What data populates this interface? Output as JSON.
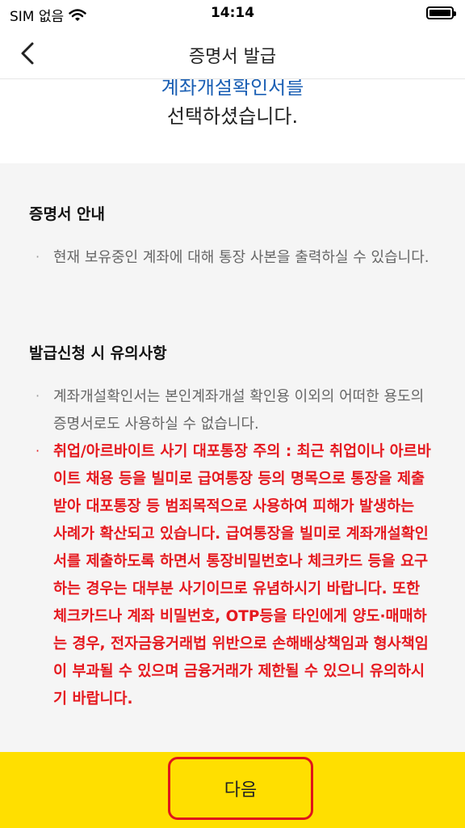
{
  "status_bar": {
    "carrier": "SIM 없음",
    "time": "14:14"
  },
  "nav": {
    "title": "증명서 발급"
  },
  "selection": {
    "document_name": "계좌개설확인서를",
    "selected_text": "선택하셨습니다."
  },
  "info": {
    "heading": "증명서 안내",
    "items": [
      "현재 보유중인 계좌에 대해 통장 사본을 출력하실 수 있습니다."
    ]
  },
  "notice": {
    "heading": "발급신청 시 유의사항",
    "items": [
      "계좌개설확인서는 본인계좌개설 확인용 이외의 어떠한 용도의 증명서로도 사용하실 수 없습니다.",
      "취업/아르바이트 사기 대포통장 주의 : 최근 취업이나 아르바이트 채용 등을 빌미로 급여통장 등의 명목으로 통장을 제출받아 대포통장 등 범죄목적으로 사용하여 피해가 발생하는 사례가 확산되고 있습니다. 급여통장을 빌미로 계좌개설확인서를 제출하도록 하면서 통장비밀번호나 체크카드 등을 요구하는 경우는 대부분 사기이므로 유념하시기 바랍니다. 또한 체크카드나 계좌 비밀번호, OTP등을 타인에게 양도·매매하는 경우, 전자금융거래법 위반으로 손해배상책임과 형사책임이 부과될 수 있으며 금융거래가 제한될 수 있으니 유의하시기 바랍니다."
    ]
  },
  "footer": {
    "next_label": "다음"
  },
  "colors": {
    "accent_yellow": "#ffdf00",
    "warning_red": "#e5191f",
    "link_blue": "#1a5fb4",
    "highlight_border": "#e0151b"
  }
}
